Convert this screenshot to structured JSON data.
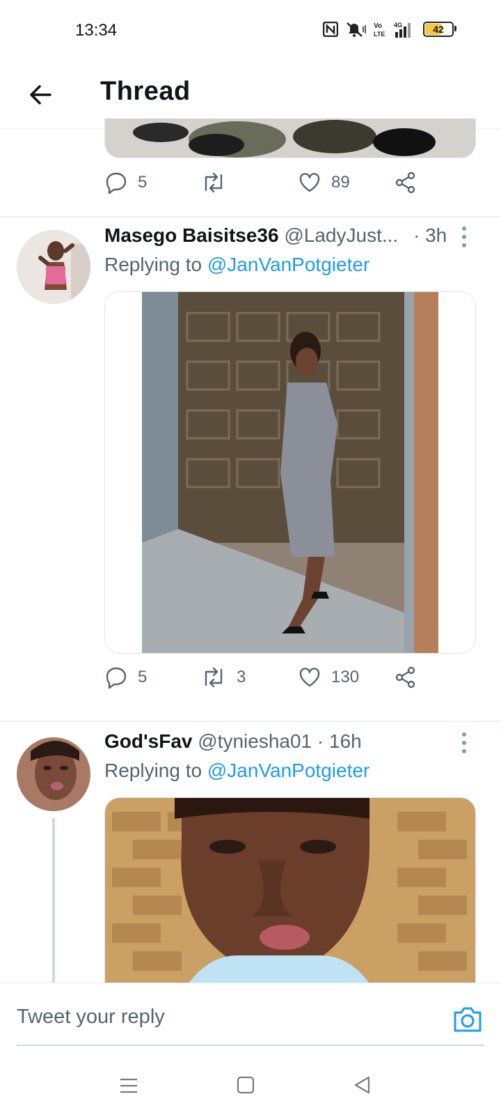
{
  "status_bar": {
    "time": "13:34",
    "battery": "42"
  },
  "header": {
    "title": "Thread"
  },
  "top_tweet": {
    "replies": "5",
    "retweets": "",
    "likes": "89"
  },
  "tweets": [
    {
      "name": "Masego Baisitse36",
      "handle": "@LadyJust...",
      "time": "· 3h",
      "replying_prefix": "Replying to ",
      "replying_to": "@JanVanPotgieter",
      "replies": "5",
      "retweets": "3",
      "likes": "130"
    },
    {
      "name": "God'sFav",
      "handle": "@tyniesha01 · 16h",
      "replying_prefix": "Replying to ",
      "replying_to": "@JanVanPotgieter"
    }
  ],
  "reply_bar": {
    "placeholder": "Tweet your reply"
  },
  "colors": {
    "accent": "#1d9bf0",
    "text": "#0f1419",
    "muted": "#536471"
  }
}
